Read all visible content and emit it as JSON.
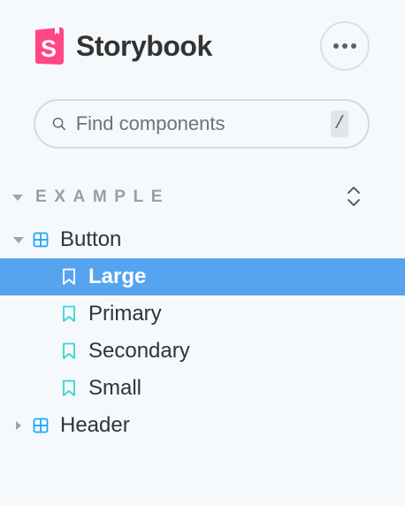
{
  "brand": {
    "name": "Storybook",
    "accent": "#ff4785"
  },
  "search": {
    "placeholder": "Find components",
    "shortcut": "/"
  },
  "section": {
    "title": "EXAMPLE"
  },
  "tree": {
    "button": {
      "label": "Button",
      "stories": [
        {
          "label": "Large",
          "selected": true
        },
        {
          "label": "Primary",
          "selected": false
        },
        {
          "label": "Secondary",
          "selected": false
        },
        {
          "label": "Small",
          "selected": false
        }
      ]
    },
    "header": {
      "label": "Header"
    }
  },
  "icons": {
    "menu": "ellipsis-icon",
    "search": "magnifier-icon",
    "component": "grid-icon",
    "story": "bookmark-icon",
    "expand": "unfold-icon"
  },
  "colors": {
    "selected": "#56a4ef",
    "component_icon": "#1ea7fd",
    "story_icon": "#37d5d3"
  }
}
